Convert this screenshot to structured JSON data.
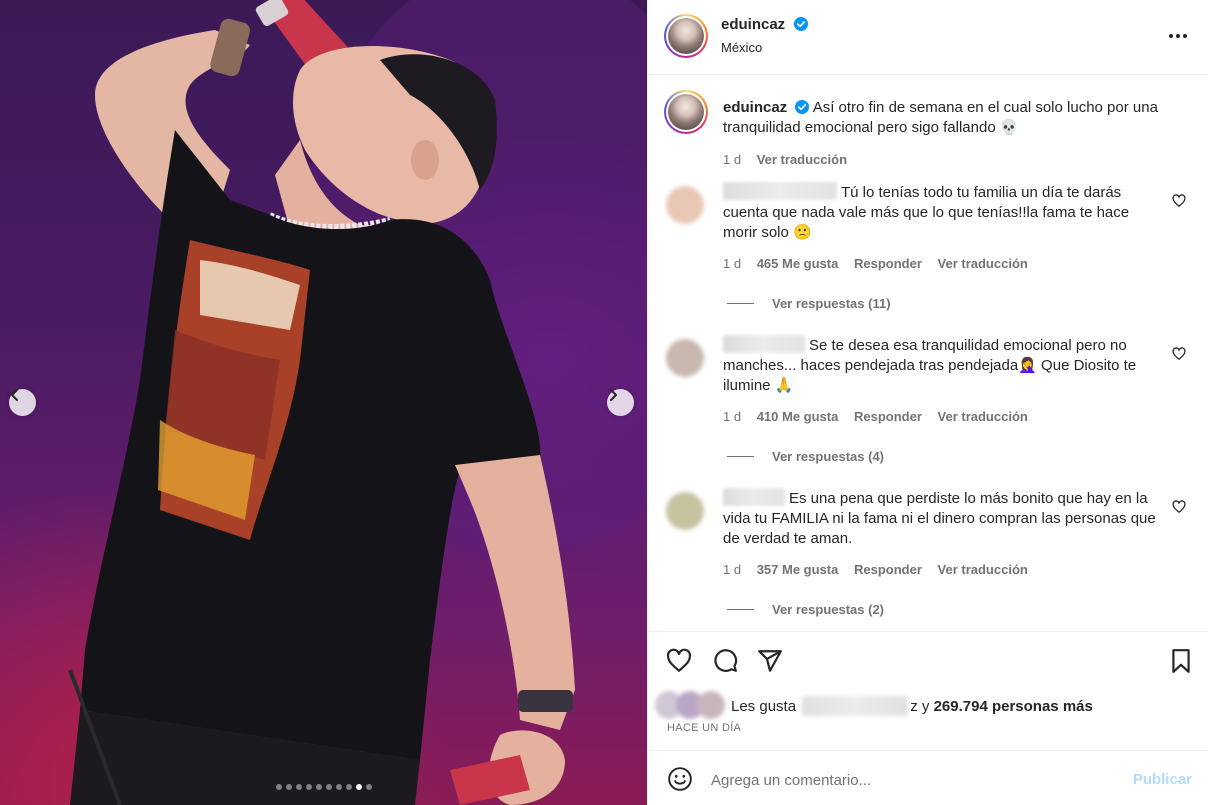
{
  "post": {
    "username": "eduincaz",
    "location": "México",
    "caption": "Así otro fin de semana en el cual solo lucho por una tranquilidad emocional pero sigo fallando 💀",
    "caption_time": "1 d",
    "caption_translate": "Ver traducción",
    "slide_count": 10,
    "active_slide": 9
  },
  "comments": [
    {
      "text": "Tú lo tenías todo tu familia un día te darás cuenta que nada vale más que lo que tenías!!la fama te hace morir solo 🙁",
      "time": "1 d",
      "likes": "465 Me gusta",
      "reply": "Responder",
      "translate": "Ver traducción",
      "replies": "Ver respuestas (11)",
      "avatar_color": "#e8c7b4"
    },
    {
      "text": "Se te desea esa tranquilidad emocional pero no manches... haces pendejada tras pendejada🤦‍♀️ Que Diosito te ilumine 🙏",
      "time": "1 d",
      "likes": "410 Me gusta",
      "reply": "Responder",
      "translate": "Ver traducción",
      "replies": "Ver respuestas (4)",
      "avatar_color": "#c9b8ae"
    },
    {
      "text": "Es una pena que perdiste lo más bonito que hay en la vida tu FAMILIA ni la fama ni el dinero compran las personas que de verdad te aman.",
      "time": "1 d",
      "likes": "357 Me gusta",
      "reply": "Responder",
      "translate": "Ver traducción",
      "replies": "Ver respuestas (2)",
      "avatar_color": "#c7c2a0"
    }
  ],
  "likes": {
    "prefix": "Les gusta",
    "suffix": "z y",
    "count_text": "269.794 personas más",
    "time_ago": "Hace un día"
  },
  "composer": {
    "placeholder": "Agrega un comentario...",
    "publish": "Publicar"
  },
  "colors": {
    "verified": "#0095f6",
    "publish_disabled": "#b3dbff",
    "muted": "#737373"
  }
}
